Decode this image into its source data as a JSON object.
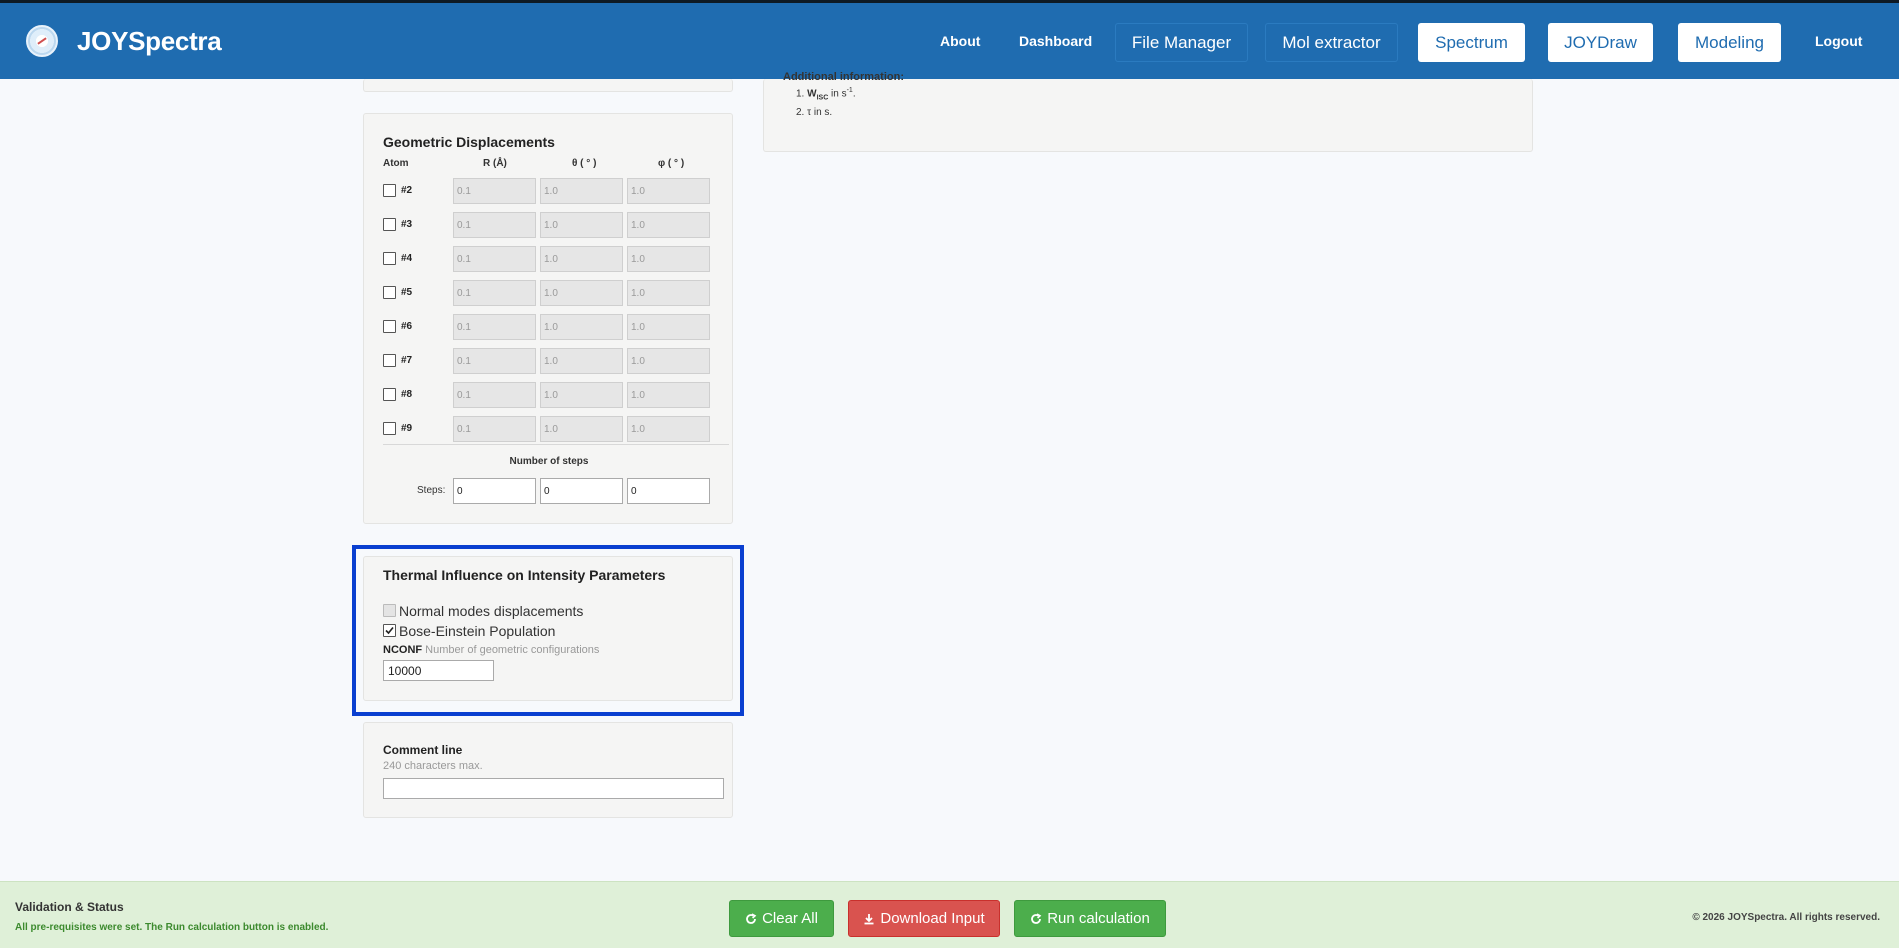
{
  "navbar": {
    "brand": "JOYSpectra",
    "links": {
      "about": "About",
      "dashboard": "Dashboard",
      "logout": "Logout"
    },
    "buttons": {
      "file_manager": "File Manager",
      "mol_extractor": "Mol extractor",
      "spectrum": "Spectrum",
      "joydraw": "JOYDraw",
      "modeling": "Modeling"
    }
  },
  "info_panel": {
    "heading": "Additional information:",
    "item1_main": "W",
    "item1_sub": "ISC",
    "item1_text": " in s",
    "item1_sup": "-1",
    "item1_end": ".",
    "item2_text": "τ in s."
  },
  "geometric": {
    "title": "Geometric Displacements",
    "headers": {
      "atom": "Atom",
      "r": "R (Å)",
      "theta": "θ ( ° )",
      "phi": "φ ( ° )"
    },
    "atoms": [
      {
        "label": "#2",
        "r": "0.1",
        "theta": "1.0",
        "phi": "1.0"
      },
      {
        "label": "#3",
        "r": "0.1",
        "theta": "1.0",
        "phi": "1.0"
      },
      {
        "label": "#4",
        "r": "0.1",
        "theta": "1.0",
        "phi": "1.0"
      },
      {
        "label": "#5",
        "r": "0.1",
        "theta": "1.0",
        "phi": "1.0"
      },
      {
        "label": "#6",
        "r": "0.1",
        "theta": "1.0",
        "phi": "1.0"
      },
      {
        "label": "#7",
        "r": "0.1",
        "theta": "1.0",
        "phi": "1.0"
      },
      {
        "label": "#8",
        "r": "0.1",
        "theta": "1.0",
        "phi": "1.0"
      },
      {
        "label": "#9",
        "r": "0.1",
        "theta": "1.0",
        "phi": "1.0"
      }
    ],
    "steps_title": "Number of steps",
    "steps_label": "Steps:",
    "steps": [
      "0",
      "0",
      "0"
    ]
  },
  "thermal": {
    "title": "Thermal Influence on Intensity Parameters",
    "option1": "Normal modes displacements",
    "option2": "Bose-Einstein Population",
    "nconf_label": "NCONF",
    "nconf_hint": "Number of geometric configurations",
    "nconf_value": "10000"
  },
  "comment": {
    "title": "Comment line",
    "hint": "240 characters max.",
    "value": ""
  },
  "footer": {
    "status_title": "Validation & Status",
    "status_message": "All pre-requisites were set. The Run calculation button is enabled.",
    "clear_all": "Clear All",
    "download_input": "Download Input",
    "run_calculation": "Run calculation",
    "copyright": "© 2026 JOYSpectra. All rights reserved."
  },
  "colors": {
    "navbar": "#1f6cb0",
    "highlight_border": "#0a3fd0",
    "success_text": "#3c8a2e",
    "danger": "#d9534f",
    "success": "#4cae4c"
  }
}
